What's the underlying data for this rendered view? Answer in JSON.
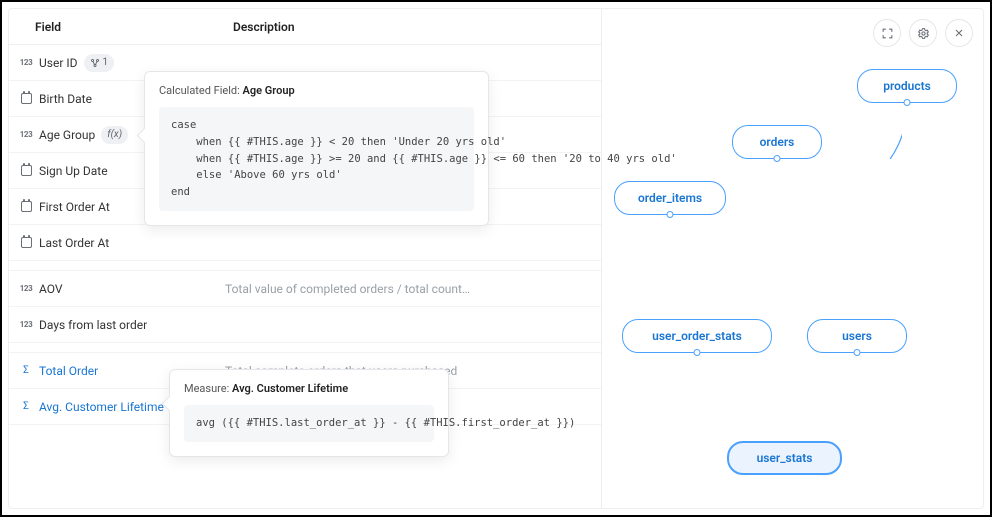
{
  "columns": {
    "field": "Field",
    "description": "Description"
  },
  "fields": [
    {
      "icon": "num",
      "name": "User ID",
      "desc": "",
      "badge": "ref",
      "badge_text": "1"
    },
    {
      "icon": "date",
      "name": "Birth Date",
      "desc": ""
    },
    {
      "icon": "num",
      "name": "Age Group",
      "desc": "",
      "badge": "fx"
    },
    {
      "icon": "date",
      "name": "Sign Up Date",
      "desc": ""
    },
    {
      "icon": "date",
      "name": "First Order At",
      "desc": ""
    },
    {
      "icon": "date",
      "name": "Last Order At",
      "desc": ""
    }
  ],
  "fields2": [
    {
      "icon": "num",
      "name": "AOV",
      "desc": "Total value of completed orders / total count…"
    },
    {
      "icon": "num",
      "name": "Days from last order",
      "desc": ""
    }
  ],
  "measures": [
    {
      "icon": "sigma",
      "name": "Total Order",
      "desc": "Total complete orders that users purchased"
    },
    {
      "icon": "sigma",
      "name": "Avg. Customer Lifetime",
      "desc": ""
    }
  ],
  "tooltip_calc": {
    "prefix": "Calculated Field: ",
    "name": "Age Group",
    "code": "case\n    when {{ #THIS.age }} < 20 then 'Under 20 yrs old'\n    when {{ #THIS.age }} >= 20 and {{ #THIS.age }} <= 60 then '20 to 40 yrs old'\n    else 'Above 60 yrs old'\nend"
  },
  "tooltip_measure": {
    "prefix": "Measure: ",
    "name": "Avg. Customer Lifetime",
    "code": "avg ({{ #THIS.last_order_at }} - {{ #THIS.first_order_at }})"
  },
  "fx_label": "f(x)",
  "nodes": {
    "products": "products",
    "orders": "orders",
    "order_items": "order_items",
    "user_order_stats": "user_order_stats",
    "users": "users",
    "user_stats": "user_stats"
  }
}
